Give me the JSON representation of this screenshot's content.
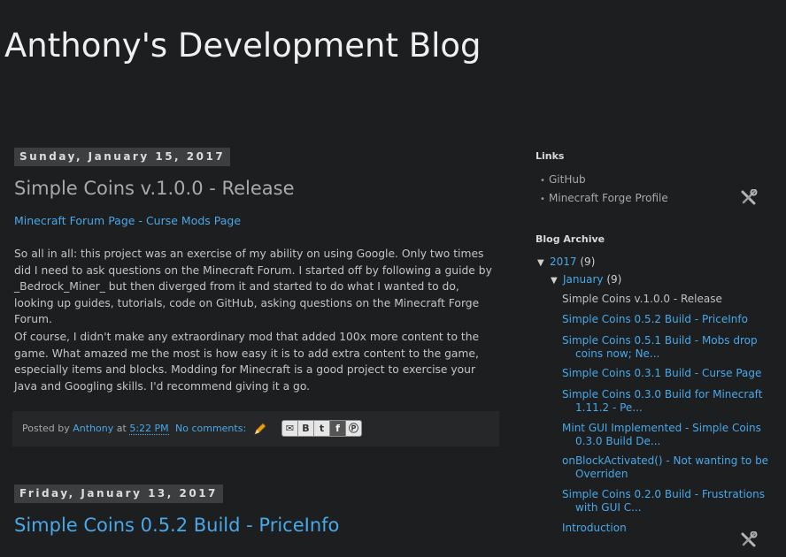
{
  "header": {
    "title": "Anthony's Development Blog"
  },
  "posts": [
    {
      "date": "Sunday, January 15, 2017",
      "title": "Simple Coins v.1.0.0 - Release",
      "links": {
        "forum": "Minecraft Forum Page",
        "sep": " - ",
        "curse": "Curse Mods Page"
      },
      "paragraphs": [
        "So all in all: this project was an exercise of my ability on using Google. Only two times did I need to ask questions on the Minecraft Forum. I started off by following a guide by _Bedrock_Miner_ but then diverged from it and started to do what I wanted to do, looking up guides, tutorials, code on GitHub, asking questions on the Minecraft Forge Forum.",
        "Of course, I didn't make any extraordinary mod that added 100x more content to the game. What amazed me the most is how easy it is to add extra content to the game, especially items and blocks. Modding for Minecraft is a good project to exercise your Java and Googling skills. I'd recommend giving it a go."
      ],
      "footer": {
        "posted_by": "Posted by",
        "author": "Anthony",
        "at": "at",
        "time": "5:22 PM",
        "comments": "No comments:"
      }
    },
    {
      "date": "Friday, January 13, 2017",
      "title": "Simple Coins 0.5.2 Build - PriceInfo"
    }
  ],
  "share_icons": [
    "email-icon",
    "blogger-icon",
    "twitter-icon",
    "facebook-icon",
    "pinterest-icon"
  ],
  "sidebar": {
    "links": {
      "heading": "Links",
      "items": [
        "GitHub",
        "Minecraft Forge Profile"
      ]
    },
    "archive": {
      "heading": "Blog Archive",
      "year": "2017",
      "year_count": "(9)",
      "month": "January",
      "month_count": "(9)",
      "posts": [
        "Simple Coins v.1.0.0 - Release",
        "Simple Coins 0.5.2 Build - PriceInfo",
        "Simple Coins 0.5.1 Build - Mobs drop coins now; Ne...",
        "Simple Coins 0.3.1 Build - Curse Page",
        "Simple Coins 0.3.0 Build for Minecraft 1.11.2 - Pe...",
        "Mint GUI Implemented - Simple Coins 0.3.0 Build De...",
        "onBlockActivated() - Not wanting to be Overriden",
        "Simple Coins 0.2.0 Build - Frustrations with GUI C...",
        "Introduction"
      ]
    }
  },
  "colors": {
    "background": "#1d1e20",
    "link": "#49a8e7",
    "date_header_bg": "#3c3e40",
    "footer_bg": "#262729"
  }
}
